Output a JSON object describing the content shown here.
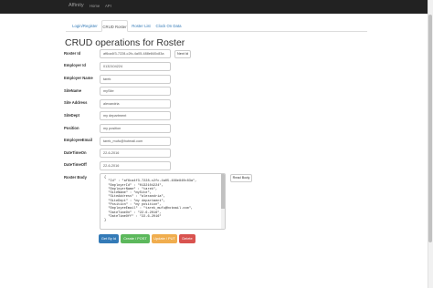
{
  "navbar": {
    "brand": "Affinity",
    "links": [
      "Home",
      "API"
    ]
  },
  "tabs": [
    {
      "label": "Login/Register",
      "active": false
    },
    {
      "label": "CRUD Roster",
      "active": true
    },
    {
      "label": "Roster List",
      "active": false
    },
    {
      "label": "Clock On Data",
      "active": false
    }
  ],
  "page_title": "CRUD operations for Roster",
  "form": {
    "roster_id": {
      "label": "Roster Id",
      "value": "af6ca4f3-7228-c2fc-4a05-488e840c83a",
      "button": "Next Id"
    },
    "employer_id": {
      "label": "Employer Id",
      "value": "0132104224"
    },
    "employer_name": {
      "label": "Employer Name",
      "value": "tarek"
    },
    "site_name": {
      "label": "SiteName",
      "value": "mySite"
    },
    "site_address": {
      "label": "Site Address",
      "value": "alexandria"
    },
    "site_dept": {
      "label": "SiteDept",
      "value": "my department"
    },
    "position": {
      "label": "Position",
      "value": "my position"
    },
    "employee_email": {
      "label": "EmployeeEmail",
      "value": "tarek_mufu@hotmail.com"
    },
    "date_time_on": {
      "label": "DateTimeOn",
      "value": "22-6-2016"
    },
    "date_time_off": {
      "label": "DateTimeOff",
      "value": "22-6-2016"
    },
    "roster_body": {
      "label": "Roster Body",
      "button": "Read Body",
      "text": "{\n  \"Id\" : \"af6ca4f3-7228-c2fc-4a05-488e840c83a\",\n  \"EmployerId\" : \"0132104224\",\n  \"EmployerName\" : \"tarek\",\n  \"SiteName\" : \"mySite\",\n  \"SiteAddress\" : \"alexandria\",\n  \"SiteDept\" : \"my department\",\n  \"Position\" : \"my position\",\n  \"EmployeeEmail\" : \"tarek_mufu@hotmail.com\",\n  \"DateTimeOn\" : \"22-6-2016\",\n  \"DateTimeOff\" : \"22-6-2016\"\n}"
    }
  },
  "actions": [
    {
      "label": "Get By Id",
      "color": "#337ab7"
    },
    {
      "label": "Create / POST",
      "color": "#5cb85c"
    },
    {
      "label": "Update / PUT",
      "color": "#f0ad4e"
    },
    {
      "label": "Delete",
      "color": "#d9534f"
    }
  ]
}
